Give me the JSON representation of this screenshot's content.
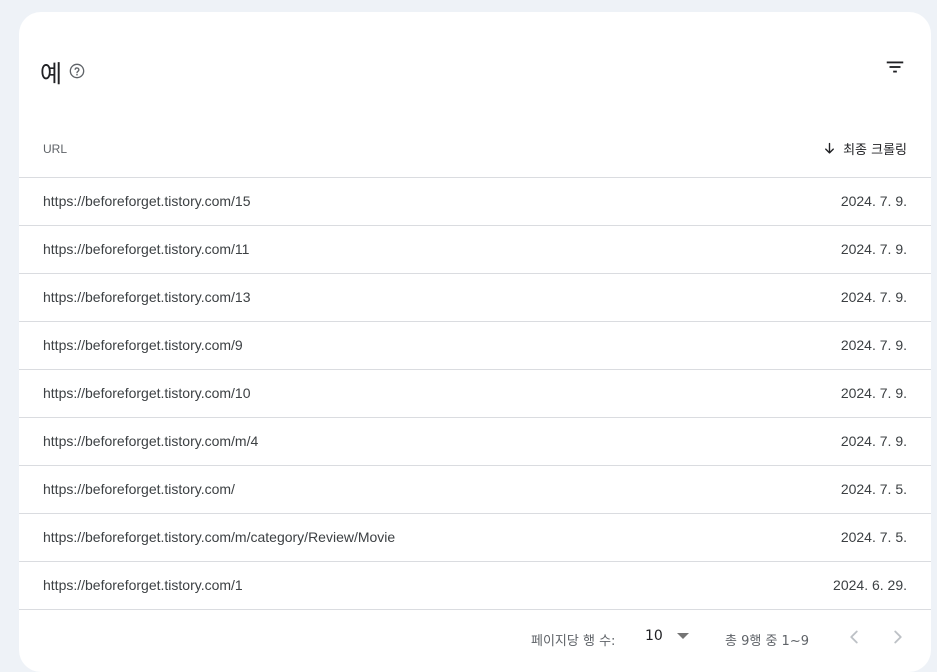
{
  "card": {
    "title": "예",
    "help_icon": "help-circle-icon",
    "filter_icon": "filter-icon"
  },
  "table": {
    "columns": {
      "url": "URL",
      "last_crawl": "최종 크롤링",
      "sort_icon": "arrow-down-icon"
    },
    "rows": [
      {
        "url": "https://beforeforget.tistory.com/15",
        "date": "2024. 7. 9."
      },
      {
        "url": "https://beforeforget.tistory.com/11",
        "date": "2024. 7. 9."
      },
      {
        "url": "https://beforeforget.tistory.com/13",
        "date": "2024. 7. 9."
      },
      {
        "url": "https://beforeforget.tistory.com/9",
        "date": "2024. 7. 9."
      },
      {
        "url": "https://beforeforget.tistory.com/10",
        "date": "2024. 7. 9."
      },
      {
        "url": "https://beforeforget.tistory.com/m/4",
        "date": "2024. 7. 9."
      },
      {
        "url": "https://beforeforget.tistory.com/",
        "date": "2024. 7. 5."
      },
      {
        "url": "https://beforeforget.tistory.com/m/category/Review/Movie",
        "date": "2024. 7. 5."
      },
      {
        "url": "https://beforeforget.tistory.com/1",
        "date": "2024. 6. 29."
      }
    ]
  },
  "pagination": {
    "rows_per_page_label": "페이지당 행 수:",
    "rows_per_page_value": "10",
    "range_text": "총 9행 중 1~9",
    "prev_icon": "chevron-left-icon",
    "next_icon": "chevron-right-icon"
  },
  "colors": {
    "background": "#eef2f7",
    "card": "#ffffff",
    "divider": "#dadce0",
    "muted": "#5f6368"
  }
}
